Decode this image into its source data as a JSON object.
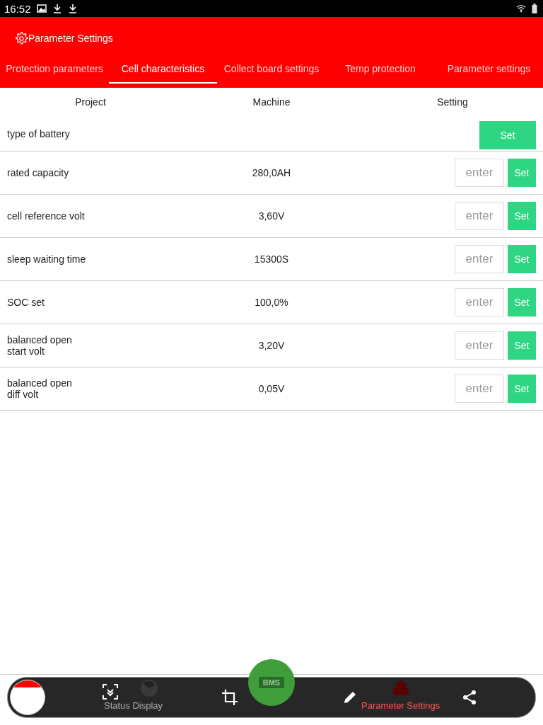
{
  "status_bar": {
    "time": "16:52"
  },
  "header": {
    "title": "Parameter Settings"
  },
  "tabs": [
    {
      "label": "Protection parameters",
      "selected": false
    },
    {
      "label": "Cell characteristics",
      "selected": true
    },
    {
      "label": "Collect board settings",
      "selected": false
    },
    {
      "label": "Temp protection",
      "selected": false
    },
    {
      "label": "Parameter settings",
      "selected": false
    }
  ],
  "table": {
    "columns": [
      "Project",
      "Machine",
      "Setting"
    ],
    "rows": [
      {
        "kind": "button",
        "name": "type of battery",
        "button": "Set"
      },
      {
        "kind": "input",
        "name": "rated capacity",
        "value": "280,0AH",
        "placeholder": "enter",
        "button": "Set"
      },
      {
        "kind": "input",
        "name": "cell reference volt",
        "value": "3,60V",
        "placeholder": "enter",
        "button": "Set"
      },
      {
        "kind": "input",
        "name": "sleep waiting time",
        "value": "15300S",
        "placeholder": "enter",
        "button": "Set"
      },
      {
        "kind": "input",
        "name": "SOC set",
        "value": "100,0%",
        "placeholder": "enter",
        "button": "Set"
      },
      {
        "kind": "input",
        "name": "balanced open\nstart volt",
        "value": "3,20V",
        "placeholder": "enter",
        "button": "Set"
      },
      {
        "kind": "input",
        "name": "balanced open\ndiff volt",
        "value": "0,05V",
        "placeholder": "enter",
        "button": "Set"
      }
    ]
  },
  "bottom_nav": [
    {
      "label": "Status Display",
      "selected": false
    },
    {
      "label": "Parameter Settings",
      "selected": true
    }
  ],
  "logo_text": "BMS"
}
